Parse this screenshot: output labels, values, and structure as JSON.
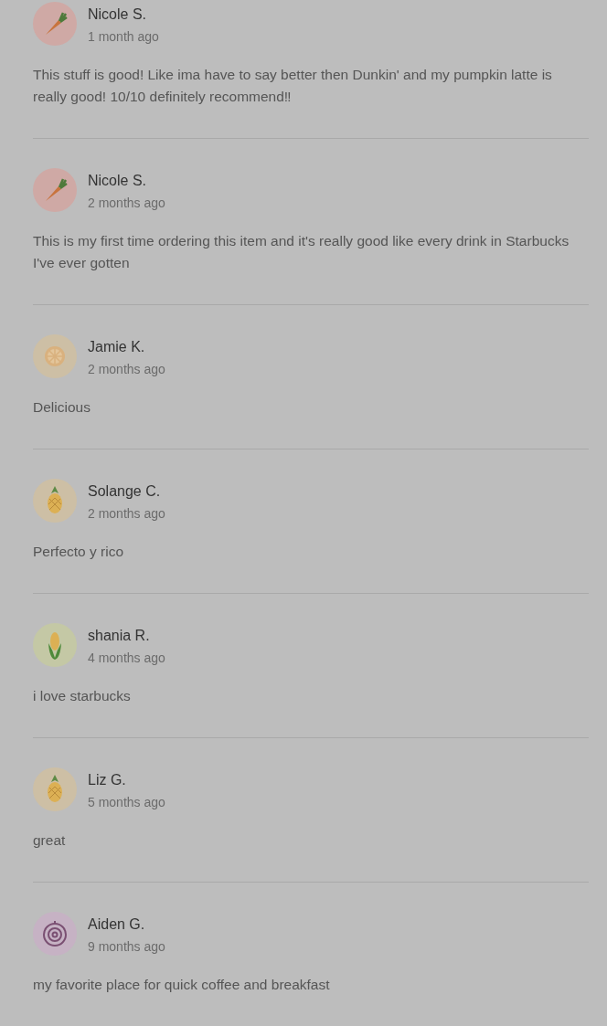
{
  "reviews": [
    {
      "avatar": {
        "kind": "carrot"
      },
      "name": "Nicole S.",
      "time": "1 month ago",
      "text": "This stuff is good! Like ima have to say better then Dunkin' and my pumpkin latte is really good! 10/10 definitely recommend‼"
    },
    {
      "avatar": {
        "kind": "carrot"
      },
      "name": "Nicole S.",
      "time": "2 months ago",
      "text": "This is my first time ordering this item and it's really good like every drink in Starbucks I've ever gotten"
    },
    {
      "avatar": {
        "kind": "orange"
      },
      "name": "Jamie K.",
      "time": "2 months ago",
      "text": "Delicious"
    },
    {
      "avatar": {
        "kind": "pineapple"
      },
      "name": "Solange C.",
      "time": "2 months ago",
      "text": "Perfecto y rico"
    },
    {
      "avatar": {
        "kind": "corn"
      },
      "name": "shania R.",
      "time": "4 months ago",
      "text": "i love starbucks"
    },
    {
      "avatar": {
        "kind": "pineapple"
      },
      "name": "Liz G.",
      "time": "5 months ago",
      "text": "great"
    },
    {
      "avatar": {
        "kind": "onion"
      },
      "name": "Aiden G.",
      "time": "9 months ago",
      "text": "my favorite place for quick coffee and breakfast"
    }
  ]
}
